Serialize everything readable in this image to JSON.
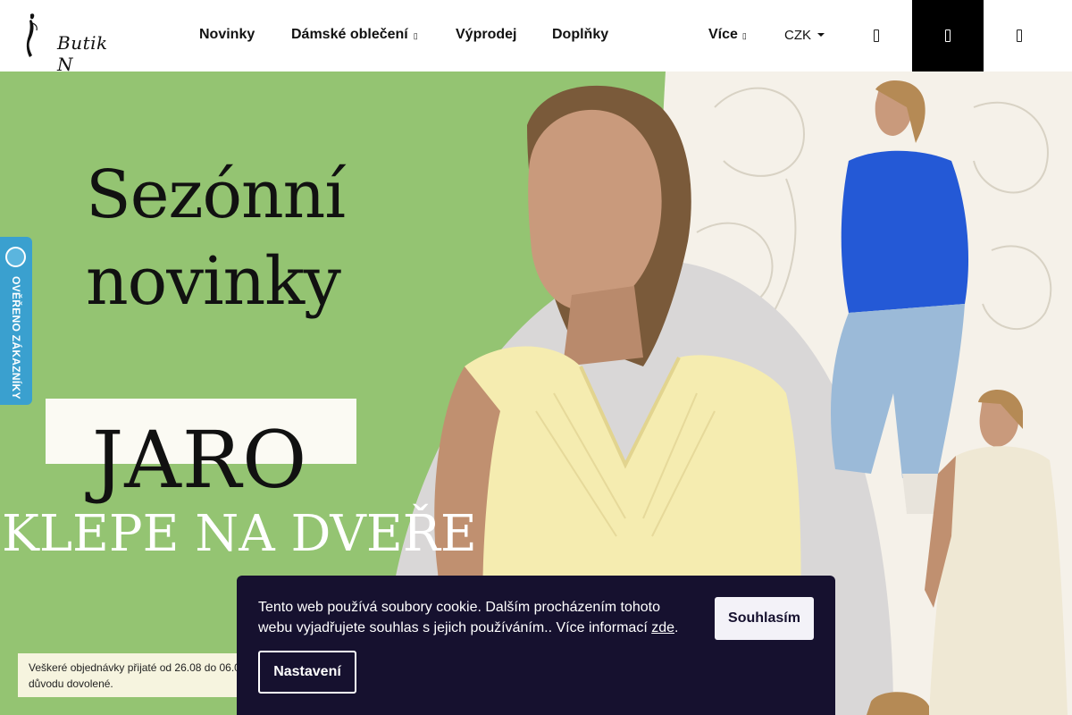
{
  "logo": {
    "text": "Butik N"
  },
  "nav": {
    "items": [
      {
        "label": "Novinky"
      },
      {
        "label": "Dámské oblečení",
        "caret": "▯"
      },
      {
        "label": "Výprodej"
      },
      {
        "label": "Doplňky"
      },
      {
        "label": "Více",
        "caret": "▯"
      }
    ],
    "currency": "CZK"
  },
  "header_icons": [
    "search-icon",
    "user-icon",
    "cart-icon"
  ],
  "hero": {
    "line1": "Sezónní",
    "line2": "novinky",
    "highlight": "JARO",
    "subline": "KLEPE NA DVEŘE"
  },
  "badge": {
    "label": "OVĚŘENO ZÁKAZNÍKY"
  },
  "notice": {
    "line1": "Veškeré objednávky přijaté od 26.08 do 06.0",
    "line2": "důvodu dovolené."
  },
  "cookie": {
    "text": "Tento web používá soubory cookie. Dalším procházením tohoto webu vyjadřujete souhlas s jejich používáním.. Více informací ",
    "link": "zde",
    "suffix": ".",
    "accept_label": "Souhlasím",
    "settings_label": "Nastavení"
  },
  "colors": {
    "hero_green": "#94c472",
    "cookie_bg": "#16112f",
    "badge_blue": "#3aa0cf",
    "notice_bg": "#f6f4df"
  }
}
